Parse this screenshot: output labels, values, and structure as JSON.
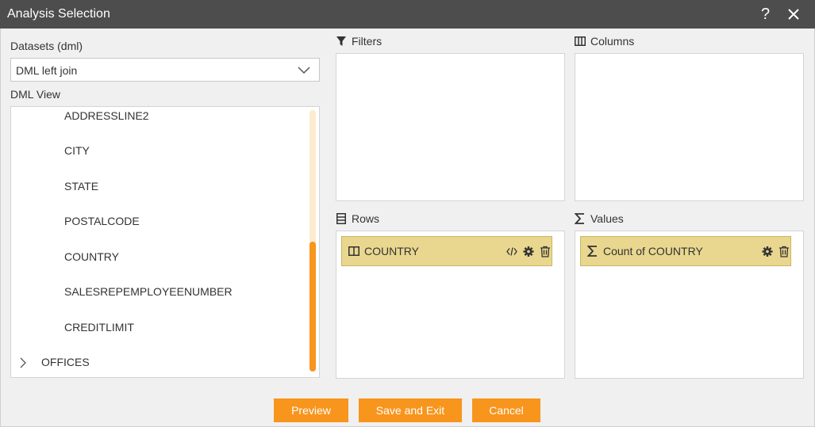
{
  "window": {
    "title": "Analysis Selection",
    "help_icon": "?"
  },
  "left": {
    "datasets_label": "Datasets (dml)",
    "dataset_selected": "DML left join",
    "view_label": "DML View",
    "tree_items": [
      "ADDRESSLINE2",
      "CITY",
      "STATE",
      "POSTALCODE",
      "COUNTRY",
      "SALESREPEMPLOYEENUMBER",
      "CREDITLIMIT"
    ],
    "tree_folder": "OFFICES"
  },
  "filters": {
    "label": "Filters"
  },
  "columns": {
    "label": "Columns"
  },
  "rows": {
    "label": "Rows",
    "items": [
      {
        "label": "COUNTRY"
      }
    ]
  },
  "values": {
    "label": "Values",
    "items": [
      {
        "label": "Count of COUNTRY"
      }
    ]
  },
  "buttons": {
    "preview": "Preview",
    "save_exit": "Save and Exit",
    "cancel": "Cancel"
  },
  "colors": {
    "accent": "#f7951d",
    "titlebar": "#4d4d4d",
    "chip": "#e9d78f"
  }
}
